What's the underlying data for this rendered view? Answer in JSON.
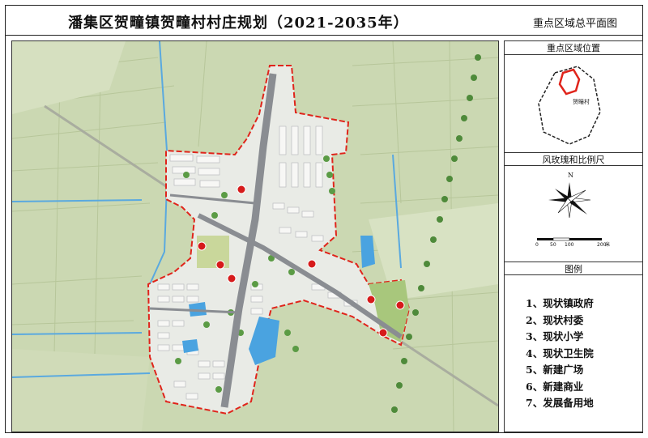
{
  "header": {
    "title": "潘集区贺疃镇贺疃村村庄规划（2021-2035年）",
    "subtitle": "重点区域总平面图"
  },
  "panels": {
    "location_title": "重点区域位置",
    "location_village_label": "贺疃村",
    "compass_title": "风玫瑰和比例尺",
    "north_label": "N",
    "scale_ticks": [
      "0",
      "50",
      "100",
      "200"
    ],
    "scale_unit": "米",
    "legend_title": "图例"
  },
  "legend": {
    "items": [
      "1、现状镇政府",
      "2、现状村委",
      "3、现状小学",
      "4、现状卫生院",
      "5、新建广场",
      "6、新建商业",
      "7、发展备用地"
    ]
  },
  "colors": {
    "boundary": "#e0241b",
    "water": "#4aa3e0",
    "field": "#c9d7b0",
    "road": "#8a8d92",
    "marker": "#d61b1b"
  }
}
